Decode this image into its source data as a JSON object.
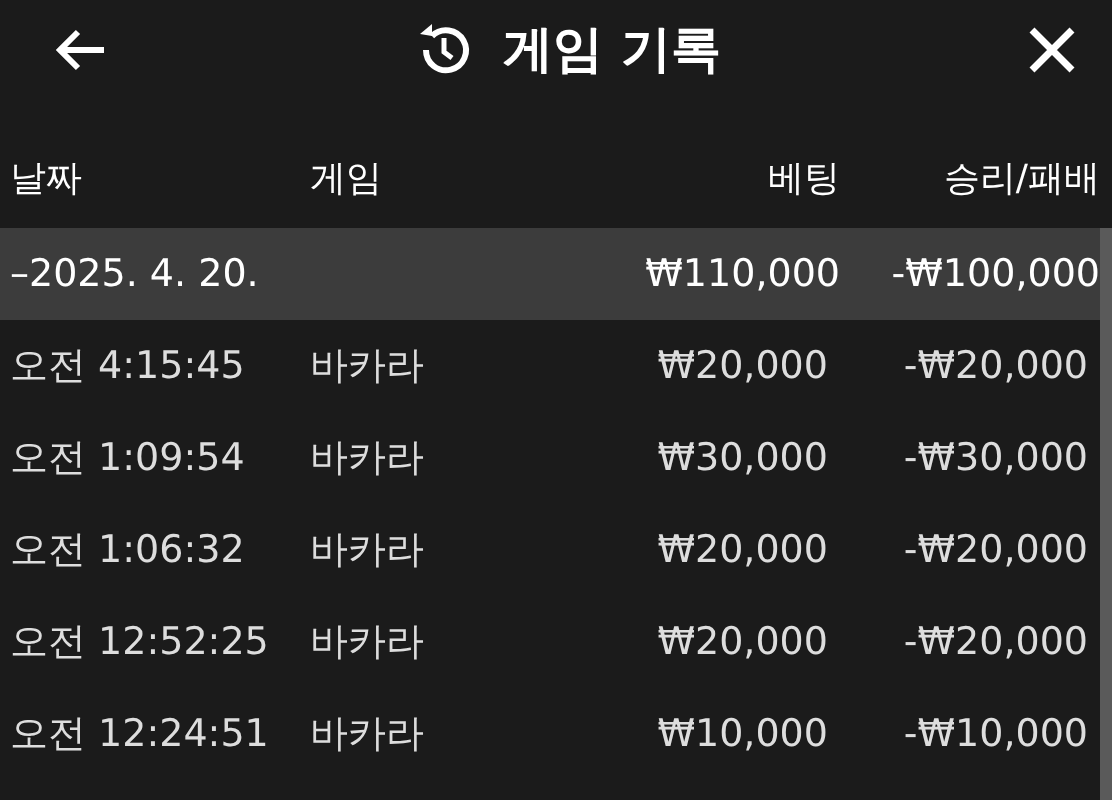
{
  "header": {
    "title": "게임 기록"
  },
  "columns": [
    "날짜",
    "게임",
    "베팅",
    "승리/패배"
  ],
  "group": {
    "toggle": "–",
    "date": "2025. 4. 20.",
    "bet": "₩110,000",
    "result": "-₩100,000"
  },
  "rows": [
    {
      "time": "오전 4:15:45",
      "game": "바카라",
      "bet": "₩20,000",
      "result": "-₩20,000"
    },
    {
      "time": "오전 1:09:54",
      "game": "바카라",
      "bet": "₩30,000",
      "result": "-₩30,000"
    },
    {
      "time": "오전 1:06:32",
      "game": "바카라",
      "bet": "₩20,000",
      "result": "-₩20,000"
    },
    {
      "time": "오전 12:52:25",
      "game": "바카라",
      "bet": "₩20,000",
      "result": "-₩20,000"
    },
    {
      "time": "오전 12:24:51",
      "game": "바카라",
      "bet": "₩10,000",
      "result": "-₩10,000"
    }
  ]
}
